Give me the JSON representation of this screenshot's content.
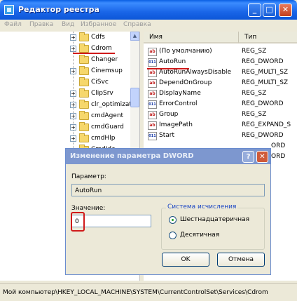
{
  "window": {
    "title": "Редактор реестра"
  },
  "menu": [
    "Файл",
    "Правка",
    "Вид",
    "Избранное",
    "Справка"
  ],
  "tree": {
    "items": [
      {
        "label": "Cdfs",
        "expandable": true
      },
      {
        "label": "Cdrom",
        "expandable": true,
        "selected": true
      },
      {
        "label": "Changer",
        "expandable": false
      },
      {
        "label": "Cinemsup",
        "expandable": true
      },
      {
        "label": "CiSvc",
        "expandable": false
      },
      {
        "label": "ClipSrv",
        "expandable": true
      },
      {
        "label": "clr_optimizat",
        "expandable": true
      },
      {
        "label": "cmdAgent",
        "expandable": true
      },
      {
        "label": "cmdGuard",
        "expandable": true
      },
      {
        "label": "cmdHlp",
        "expandable": true
      },
      {
        "label": "CmdIde",
        "expandable": false
      }
    ]
  },
  "values": {
    "headers": {
      "name": "Имя",
      "type": "Тип"
    },
    "rows": [
      {
        "name": "(По умолчанию)",
        "type": "REG_SZ",
        "icon": "string-value-icon"
      },
      {
        "name": "AutoRun",
        "type": "REG_DWORD",
        "icon": "binary-value-icon"
      },
      {
        "name": "AutoRunAlwaysDisable",
        "type": "REG_MULTI_SZ",
        "icon": "string-value-icon"
      },
      {
        "name": "DependOnGroup",
        "type": "REG_MULTI_SZ",
        "icon": "string-value-icon"
      },
      {
        "name": "DisplayName",
        "type": "REG_SZ",
        "icon": "string-value-icon"
      },
      {
        "name": "ErrorControl",
        "type": "REG_DWORD",
        "icon": "binary-value-icon"
      },
      {
        "name": "Group",
        "type": "REG_SZ",
        "icon": "string-value-icon"
      },
      {
        "name": "ImagePath",
        "type": "REG_EXPAND_S",
        "icon": "string-value-icon"
      },
      {
        "name": "Start",
        "type": "REG_DWORD",
        "icon": "binary-value-icon"
      },
      {
        "name": "",
        "type": "ORD",
        "icon": ""
      },
      {
        "name": "",
        "type": "ORD",
        "icon": ""
      }
    ]
  },
  "statusbar": {
    "path": "Мой компьютер\\HKEY_LOCAL_MACHINE\\SYSTEM\\CurrentControlSet\\Services\\Cdrom"
  },
  "dialog": {
    "title": "Изменение параметра DWORD",
    "param_label": "Параметр:",
    "param_value": "AutoRun",
    "value_label": "Значение:",
    "value": "0",
    "base_group": "Система исчисления",
    "radio_hex": "Шестнадцатеричная",
    "radio_dec": "Десятичная",
    "ok": "OK",
    "cancel": "Отмена"
  },
  "colors": {
    "annotation": "#d01a1a",
    "titlebar": "#1a66e8"
  }
}
